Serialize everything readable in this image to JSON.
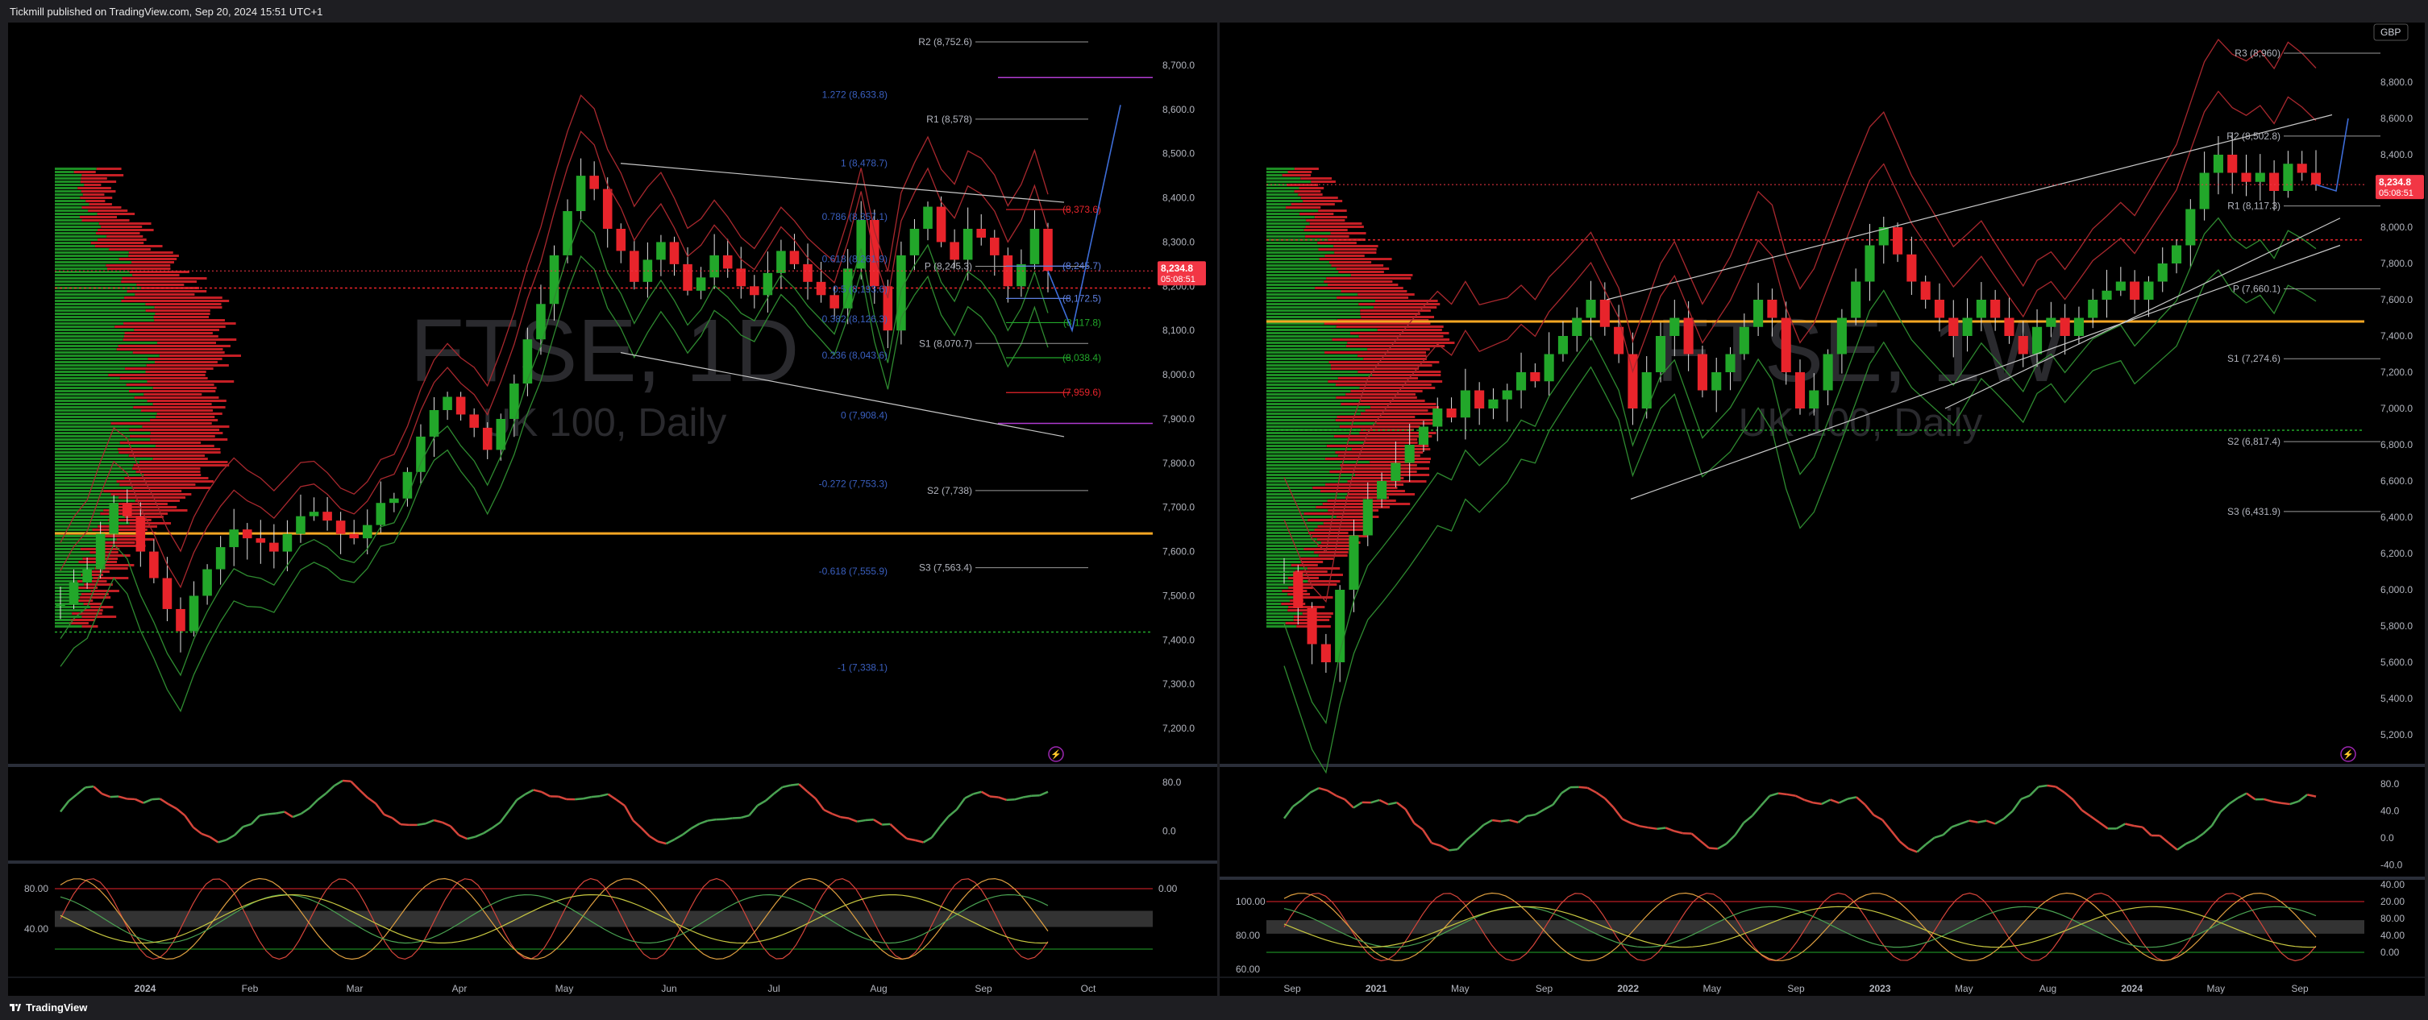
{
  "header": {
    "publisher_line": "Tickmill published on TradingView.com, Sep 20, 2024 15:51 UTC+1"
  },
  "footer": {
    "brand": "TradingView"
  },
  "colors": {
    "background": "#000000",
    "up": "#22a72a",
    "down": "#e8242b",
    "band_red": "#a8282e",
    "band_green": "#2e8a30",
    "support_orange": "#f5a623",
    "price_tag": "#f23645",
    "fib_blue": "#3a5fbf",
    "pivot_purple": "#b03bd1"
  },
  "chart_data": [
    {
      "type": "candlestick",
      "name": "left-daily",
      "watermark_symbol": "FTSE, 1D",
      "watermark_desc": "UK 100, Daily",
      "yticks": [
        "8,700.0",
        "8,600.0",
        "8,500.0",
        "8,400.0",
        "8,300.0",
        "8,200.0",
        "8,100.0",
        "8,000.0",
        "7,900.0",
        "7,800.0",
        "7,700.0",
        "7,600.0",
        "7,500.0",
        "7,400.0",
        "7,300.0",
        "7,200.0"
      ],
      "ylim": [
        7120,
        8760
      ],
      "xticks": [
        "2024",
        "Feb",
        "Mar",
        "Apr",
        "May",
        "Jun",
        "Jul",
        "Aug",
        "Sep",
        "Oct"
      ],
      "last_price": "8,234.8",
      "countdown": "05:08:51",
      "pivots": [
        {
          "label": "R2 (8,752.6)",
          "value": 8752.6
        },
        {
          "label": "R1 (8,578)",
          "value": 8578
        },
        {
          "label": "P (8,245.3)",
          "value": 8245.3
        },
        {
          "label": "S1 (8,070.7)",
          "value": 8070.7
        },
        {
          "label": "S2 (7,738)",
          "value": 7738
        },
        {
          "label": "S3 (7,563.4)",
          "value": 7563.4
        }
      ],
      "fib_levels": [
        {
          "label": "1.272 (8,633.8)",
          "value": 8633.8
        },
        {
          "label": "1 (8,478.7)",
          "value": 8478.7
        },
        {
          "label": "0.786 (8,357.1)",
          "value": 8357.1
        },
        {
          "label": "0.618 (8,261.9)",
          "value": 8261.9
        },
        {
          "label": "0.5 (8,193.6)",
          "value": 8193.6
        },
        {
          "label": "0.382 (8,126.3)",
          "value": 8126.3
        },
        {
          "label": "0.236 (8,043.6)",
          "value": 8043.6
        },
        {
          "label": "0 (7,908.4)",
          "value": 7908.4
        },
        {
          "label": "-0.272 (7,753.3)",
          "value": 7753.3
        },
        {
          "label": "-0.618 (7,555.9)",
          "value": 7555.9
        },
        {
          "label": "-1 (7,338.1)",
          "value": 7338.1
        }
      ],
      "projection_levels": [
        {
          "label": "(8,373.6)",
          "value": 8373.6,
          "color": "#e8242b"
        },
        {
          "label": "(8,245.7)",
          "value": 8245.7,
          "color": "#5d7fe0"
        },
        {
          "label": "(8,172.5)",
          "value": 8172.5,
          "color": "#5d7fe0"
        },
        {
          "label": "(8,117.8)",
          "value": 8117.8,
          "color": "#22a72a"
        },
        {
          "label": "(8,038.4)",
          "value": 8038.4,
          "color": "#22a72a"
        },
        {
          "label": "(7,959.6)",
          "value": 7959.6,
          "color": "#e8242b"
        }
      ],
      "support_line": 7641,
      "dotted_red_line": 8196,
      "dotted_green_line": 7418,
      "pivot_purple_top": 8672,
      "pivot_purple_bottom": 7890,
      "close_path": [
        7480,
        7530,
        7560,
        7640,
        7710,
        7680,
        7600,
        7540,
        7470,
        7420,
        7500,
        7560,
        7610,
        7650,
        7630,
        7620,
        7600,
        7640,
        7680,
        7690,
        7670,
        7640,
        7630,
        7660,
        7710,
        7720,
        7780,
        7860,
        7920,
        7950,
        7910,
        7880,
        7830,
        7900,
        7980,
        8080,
        8160,
        8270,
        8370,
        8450,
        8420,
        8330,
        8280,
        8210,
        8260,
        8300,
        8250,
        8190,
        8220,
        8270,
        8240,
        8200,
        8180,
        8230,
        8280,
        8250,
        8210,
        8180,
        8150,
        8240,
        8350,
        8200,
        8100,
        8270,
        8330,
        8380,
        8300,
        8260,
        8330,
        8310,
        8270,
        8200,
        8250,
        8330,
        8234.8
      ],
      "oscillator_top": {
        "yticks": [
          "80.0",
          "0.0"
        ],
        "ylim": [
          -40,
          100
        ]
      },
      "oscillator_bottom": {
        "yticks": [
          "80.00",
          "40.00",
          "0.00"
        ],
        "ylim": [
          0,
          100
        ]
      }
    },
    {
      "type": "candlestick",
      "name": "right-weekly",
      "watermark_symbol": "FTSE, 1W",
      "watermark_desc": "UK 100, Daily",
      "currency": "GBP",
      "yticks": [
        "8,800.0",
        "8,600.0",
        "8,400.0",
        "8,200.0",
        "8,000.0",
        "7,800.0",
        "7,600.0",
        "7,400.0",
        "7,200.0",
        "7,000.0",
        "6,800.0",
        "6,600.0",
        "6,400.0",
        "6,200.0",
        "6,000.0",
        "5,800.0",
        "5,600.0",
        "5,400.0",
        "5,200.0"
      ],
      "ylim": [
        5040,
        9040
      ],
      "xticks": [
        "Sep",
        "2021",
        "May",
        "Sep",
        "2022",
        "May",
        "Sep",
        "2023",
        "May",
        "Aug",
        "2024",
        "May",
        "Sep"
      ],
      "last_price": "8,234.8",
      "countdown": "05:08:51",
      "pivots": [
        {
          "label": "R3 (8,960)",
          "value": 8960
        },
        {
          "label": "R2 (8,502.8)",
          "value": 8502.8
        },
        {
          "label": "R1 (8,117.3)",
          "value": 8117.3
        },
        {
          "label": "P (7,660.1)",
          "value": 7660.1
        },
        {
          "label": "S1 (7,274.6)",
          "value": 7274.6
        },
        {
          "label": "S2 (6,817.4)",
          "value": 6817.4
        },
        {
          "label": "S3 (6,431.9)",
          "value": 6431.9
        }
      ],
      "support_line": 7480,
      "dotted_red_line": 7930,
      "dotted_green_line": 6880,
      "close_path": [
        6100,
        5900,
        5700,
        5600,
        6000,
        6300,
        6500,
        6600,
        6700,
        6800,
        6900,
        7000,
        6950,
        7100,
        7000,
        7050,
        7100,
        7200,
        7150,
        7300,
        7400,
        7500,
        7600,
        7450,
        7300,
        7000,
        7200,
        7400,
        7500,
        7300,
        7100,
        7200,
        7300,
        7450,
        7600,
        7500,
        7200,
        7000,
        7100,
        7300,
        7500,
        7700,
        7900,
        8000,
        7850,
        7700,
        7600,
        7500,
        7400,
        7500,
        7600,
        7500,
        7400,
        7300,
        7450,
        7500,
        7400,
        7500,
        7600,
        7650,
        7700,
        7600,
        7700,
        7800,
        7900,
        8100,
        8300,
        8400,
        8300,
        8250,
        8300,
        8200,
        8350,
        8300,
        8234.8
      ],
      "oscillator_top": {
        "yticks": [
          "80.0",
          "40.0",
          "0.0",
          "-40.0"
        ],
        "ylim": [
          -50,
          100
        ]
      },
      "oscillator_bottom": {
        "yticks": [
          "100.00",
          "80.00",
          "60.00",
          "40.00",
          "20.00",
          "80.00",
          "40.00",
          "0.00"
        ],
        "ylim": [
          0,
          100
        ]
      }
    }
  ]
}
